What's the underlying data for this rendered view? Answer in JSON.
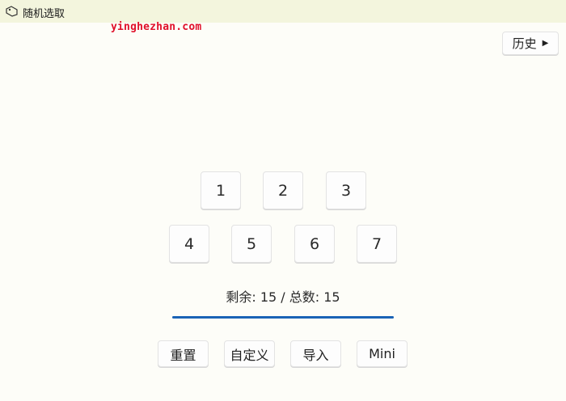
{
  "window": {
    "title": "随机选取",
    "icon": "app-tag-icon"
  },
  "watermark": "yinghezhan.com",
  "header": {
    "history_label": "历史",
    "history_arrow": "▶"
  },
  "numbers": [
    "1",
    "2",
    "3",
    "4",
    "5",
    "6",
    "7"
  ],
  "status": {
    "text": "剩余: 15 / 总数: 15",
    "remaining": 15,
    "total": 15,
    "progress_fraction": 1.0
  },
  "actions": {
    "reset": "重置",
    "custom": "自定义",
    "import": "导入",
    "mini": "Mini"
  },
  "colors": {
    "accent": "#1a63b6",
    "titlebar": "#f3f5dd",
    "watermark": "#e0102a"
  }
}
